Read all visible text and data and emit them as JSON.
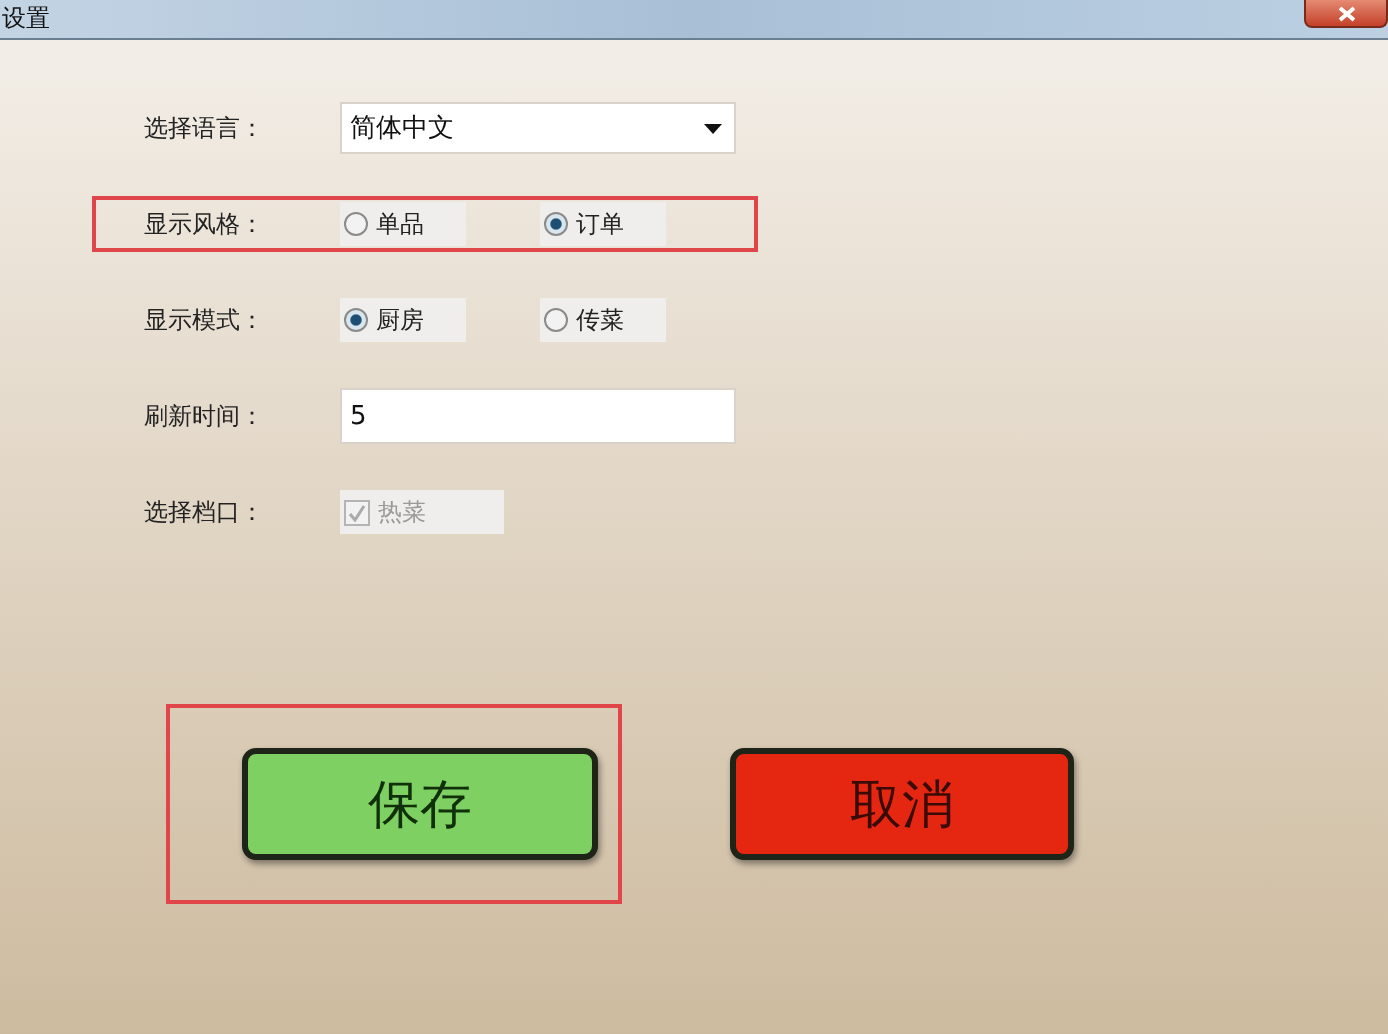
{
  "window": {
    "title": "设置"
  },
  "rows": [
    {
      "kind": "select",
      "label": "选择语言：",
      "value": "简体中文",
      "highlighted": false
    },
    {
      "kind": "radio",
      "label": "显示风格：",
      "highlighted": true,
      "options": [
        {
          "label": "单品",
          "selected": false
        },
        {
          "label": "订单",
          "selected": true
        }
      ]
    },
    {
      "kind": "radio",
      "label": "显示模式：",
      "highlighted": false,
      "options": [
        {
          "label": "厨房",
          "selected": true
        },
        {
          "label": "传菜",
          "selected": false
        }
      ]
    },
    {
      "kind": "input",
      "label": "刷新时间：",
      "value": "5",
      "highlighted": false
    },
    {
      "kind": "checkbox",
      "label": "选择档口：",
      "highlighted": false,
      "option": {
        "label": "热菜",
        "checked": true,
        "disabled": true
      }
    }
  ],
  "buttons": [
    {
      "kind": "save",
      "label": "保存",
      "highlighted": true
    },
    {
      "kind": "cancel",
      "label": "取消",
      "highlighted": false
    }
  ]
}
